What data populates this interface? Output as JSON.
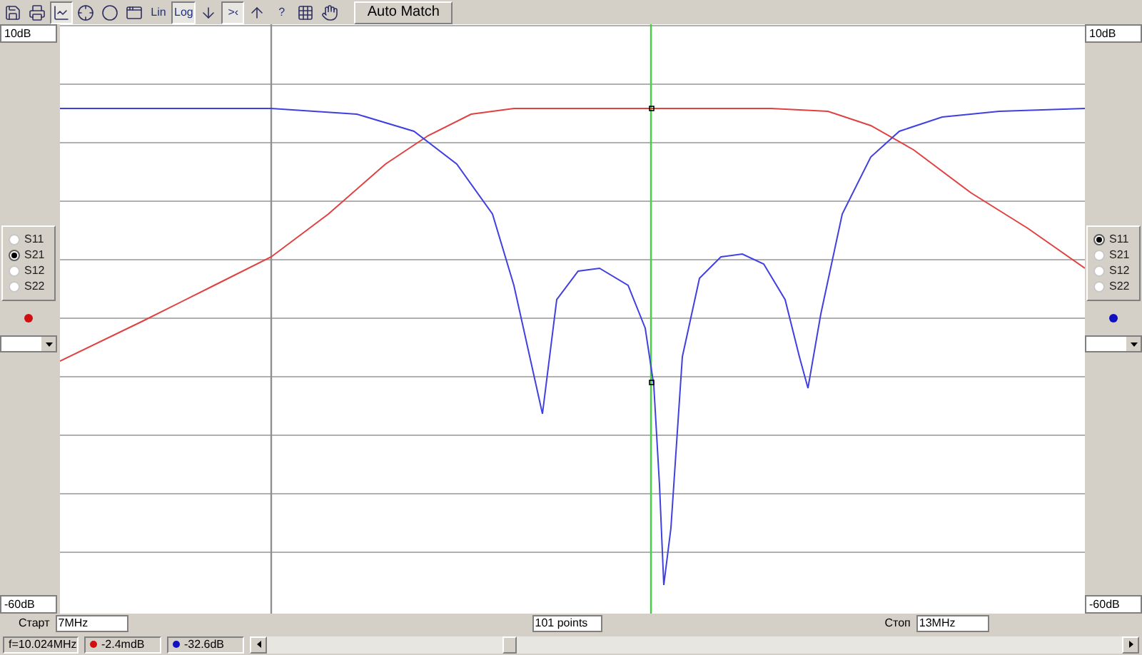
{
  "toolbar": [
    {
      "kind": "icon",
      "pressed": false
    },
    {
      "kind": "icon",
      "pressed": false
    },
    {
      "kind": "icon",
      "pressed": true
    },
    {
      "kind": "icon",
      "pressed": false
    },
    {
      "kind": "icon",
      "pressed": false
    },
    {
      "kind": "icon",
      "pressed": false
    },
    {
      "kind": "text",
      "label": "Lin",
      "pressed": false
    },
    {
      "kind": "text",
      "label": "Log",
      "pressed": true
    },
    {
      "kind": "icon",
      "pressed": false
    },
    {
      "kind": "text",
      "label": ">‹",
      "pressed": true
    },
    {
      "kind": "icon",
      "pressed": false
    },
    {
      "kind": "text",
      "label": "?",
      "pressed": false
    },
    {
      "kind": "icon",
      "pressed": false
    },
    {
      "kind": "icon",
      "pressed": false
    },
    {
      "kind": "button",
      "label": "Auto Match",
      "pressed": false
    }
  ],
  "left_panel": {
    "top_value": "10dB",
    "bottom_value": "-60dB",
    "params": [
      {
        "label": "S11",
        "selected": false
      },
      {
        "label": "S21",
        "selected": true
      },
      {
        "label": "S12",
        "selected": false
      },
      {
        "label": "S22",
        "selected": false
      }
    ],
    "color": "#d01010"
  },
  "right_panel": {
    "top_value": "10dB",
    "bottom_value": "-60dB",
    "params": [
      {
        "label": "S11",
        "selected": true
      },
      {
        "label": "S21",
        "selected": false
      },
      {
        "label": "S12",
        "selected": false
      },
      {
        "label": "S22",
        "selected": false
      }
    ],
    "color": "#1010c0"
  },
  "sweep": {
    "start_label": "Старт",
    "start_value": "7MHz",
    "points": "101 points",
    "stop_label": "Стоп",
    "stop_value": "13MHz"
  },
  "status_bar": {
    "frequency": "f=10.024MHz",
    "readings": [
      {
        "value": "-2.4mdB",
        "color": "#d01010"
      },
      {
        "value": "-32.6dB",
        "color": "#1010c0"
      }
    ]
  }
}
